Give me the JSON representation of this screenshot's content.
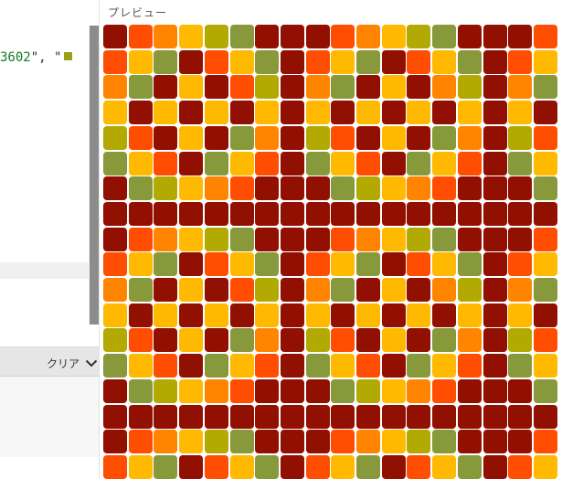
{
  "editor": {
    "code_fragment": "3602",
    "code_punct": "\", \""
  },
  "console": {
    "clear_label": "クリア"
  },
  "preview": {
    "title": "プレビュー",
    "palette": [
      "#921001",
      "#ff4e01",
      "#ff8501",
      "#ffb901",
      "#b2aa02",
      "#88993b"
    ],
    "grid_rows": [
      [
        0,
        1,
        2,
        3,
        4,
        5,
        0,
        0,
        0,
        1,
        2,
        3,
        4,
        5,
        0,
        0,
        0,
        1
      ],
      [
        1,
        3,
        5,
        0,
        1,
        3,
        5,
        0,
        1,
        3,
        5,
        0,
        1,
        3,
        5,
        0,
        1,
        3
      ],
      [
        2,
        5,
        0,
        3,
        0,
        1,
        4,
        0,
        2,
        5,
        0,
        3,
        0,
        2,
        4,
        0,
        2,
        5
      ],
      [
        3,
        0,
        3,
        0,
        3,
        0,
        3,
        0,
        3,
        0,
        3,
        0,
        3,
        0,
        3,
        0,
        3,
        0
      ],
      [
        4,
        1,
        0,
        3,
        0,
        5,
        2,
        0,
        4,
        1,
        0,
        3,
        0,
        5,
        2,
        0,
        4,
        1
      ],
      [
        5,
        3,
        1,
        0,
        5,
        3,
        1,
        0,
        5,
        3,
        1,
        0,
        5,
        3,
        1,
        0,
        5,
        3
      ],
      [
        0,
        5,
        4,
        3,
        2,
        1,
        0,
        0,
        0,
        5,
        4,
        3,
        2,
        1,
        0,
        0,
        0,
        5
      ],
      [
        0,
        0,
        0,
        0,
        0,
        0,
        0,
        0,
        0,
        0,
        0,
        0,
        0,
        0,
        0,
        0,
        0,
        0
      ],
      [
        0,
        1,
        2,
        3,
        4,
        5,
        0,
        0,
        0,
        1,
        2,
        3,
        4,
        5,
        0,
        0,
        0,
        1
      ],
      [
        1,
        3,
        5,
        0,
        1,
        3,
        5,
        0,
        1,
        3,
        5,
        0,
        1,
        3,
        5,
        0,
        1,
        3
      ],
      [
        2,
        5,
        0,
        3,
        0,
        1,
        4,
        0,
        2,
        5,
        0,
        3,
        0,
        2,
        4,
        0,
        2,
        5
      ],
      [
        3,
        0,
        3,
        0,
        3,
        0,
        3,
        0,
        3,
        0,
        3,
        0,
        3,
        0,
        3,
        0,
        3,
        0
      ],
      [
        4,
        1,
        0,
        3,
        0,
        5,
        2,
        0,
        4,
        1,
        0,
        3,
        0,
        5,
        2,
        0,
        4,
        1
      ],
      [
        5,
        3,
        1,
        0,
        5,
        3,
        1,
        0,
        5,
        3,
        1,
        0,
        5,
        3,
        1,
        0,
        5,
        3
      ],
      [
        0,
        5,
        4,
        3,
        2,
        1,
        0,
        0,
        0,
        5,
        4,
        3,
        2,
        1,
        0,
        0,
        0,
        5
      ],
      [
        0,
        0,
        0,
        0,
        0,
        0,
        0,
        0,
        0,
        0,
        0,
        0,
        0,
        0,
        0,
        0,
        0,
        0
      ],
      [
        0,
        1,
        2,
        3,
        4,
        5,
        0,
        0,
        0,
        1,
        2,
        3,
        4,
        5,
        0,
        0,
        0,
        1
      ],
      [
        1,
        3,
        5,
        0,
        1,
        3,
        5,
        0,
        1,
        3,
        5,
        0,
        1,
        3,
        5,
        0,
        1,
        3
      ]
    ]
  }
}
